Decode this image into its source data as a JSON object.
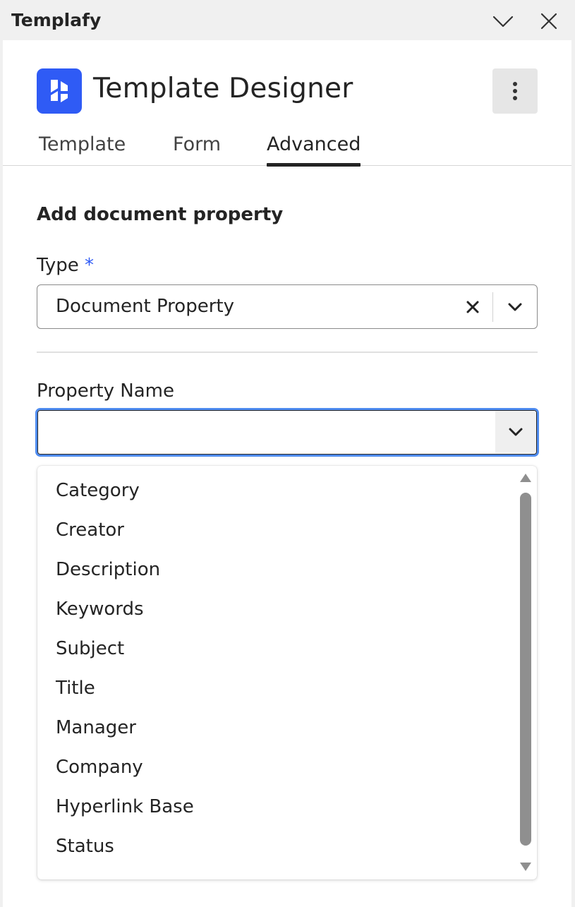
{
  "window": {
    "title": "Templafy",
    "collapse_icon": "chevron-down-icon",
    "close_icon": "close-icon"
  },
  "header": {
    "title": "Template Designer",
    "logo_icon": "templafy-logo-icon",
    "more_icon": "more-vertical-icon",
    "accent_color": "#2f5bf5"
  },
  "tabs": [
    {
      "label": "Template",
      "active": false
    },
    {
      "label": "Form",
      "active": false
    },
    {
      "label": "Advanced",
      "active": true
    }
  ],
  "form": {
    "heading": "Add document property",
    "type_label": "Type",
    "required_marker": "*",
    "type_value": "Document Property",
    "property_name_label": "Property Name",
    "property_name_value": ""
  },
  "dropdown": {
    "options": [
      "Category",
      "Creator",
      "Description",
      "Keywords",
      "Subject",
      "Title",
      "Manager",
      "Company",
      "Hyperlink Base",
      "Status"
    ]
  }
}
